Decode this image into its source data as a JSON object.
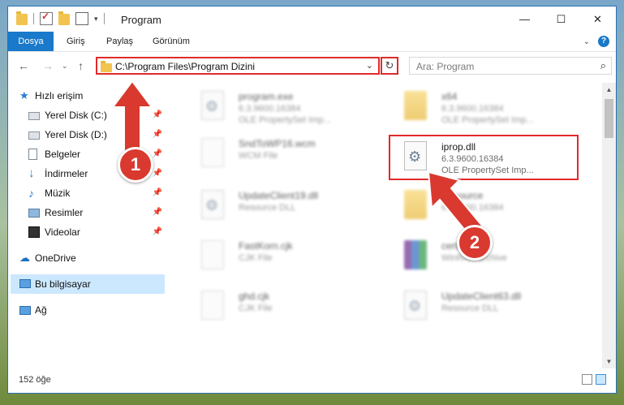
{
  "window": {
    "title": "Program",
    "controls": {
      "minimize": "—",
      "maximize": "☐",
      "close": "✕"
    }
  },
  "ribbon": {
    "tabs": [
      "Dosya",
      "Giriş",
      "Paylaş",
      "Görünüm"
    ],
    "accent": "#1979ca"
  },
  "address": {
    "path": "C:\\Program Files\\Program Dizini",
    "search_placeholder": "Ara: Program"
  },
  "sidebar": {
    "quick_access": "Hızlı erişim",
    "pinned": [
      {
        "label": "Yerel Disk (C:)",
        "icon": "drive-icon"
      },
      {
        "label": "Yerel Disk (D:)",
        "icon": "drive-icon"
      },
      {
        "label": "Belgeler",
        "icon": "documents-icon"
      },
      {
        "label": "İndirmeler",
        "icon": "download-icon"
      },
      {
        "label": "Müzik",
        "icon": "music-icon"
      },
      {
        "label": "Resimler",
        "icon": "pictures-icon"
      },
      {
        "label": "Videolar",
        "icon": "videos-icon"
      }
    ],
    "onedrive": "OneDrive",
    "this_pc": "Bu bilgisayar",
    "network": "Ağ"
  },
  "files": [
    {
      "name": "program.exe",
      "meta1": "6.3.9600.16384",
      "meta2": "OLE PropertySet Imp...",
      "icon": "exe-icon"
    },
    {
      "name": "x64",
      "meta1": "6.3.9600.16384",
      "meta2": "OLE PropertySet Imp...",
      "icon": "folder-icon"
    },
    {
      "name": "SndToWP16.wcm",
      "meta1": "WCM File",
      "meta2": "",
      "icon": "document-icon"
    },
    {
      "name": "iprop.dll",
      "meta1": "6.3.9600.16384",
      "meta2": "OLE PropertySet Imp...",
      "icon": "dll-gear-icon"
    },
    {
      "name": "UpdateClient19.dll",
      "meta1": "Resource DLL",
      "meta2": "",
      "icon": "dll-gear-icon"
    },
    {
      "name": "Resource",
      "meta1": "6.3.9600.16384",
      "meta2": "",
      "icon": "folder-icon"
    },
    {
      "name": "FastKorn.cjk",
      "meta1": "CJK File",
      "meta2": "",
      "icon": "document-icon"
    },
    {
      "name": "certif...cab",
      "meta1": "WinRAR archive",
      "meta2": "",
      "icon": "archive-icon"
    },
    {
      "name": "ghd.cjk",
      "meta1": "CJK File",
      "meta2": "",
      "icon": "document-icon"
    },
    {
      "name": "UpdateClient63.dll",
      "meta1": "Resource DLL",
      "meta2": "",
      "icon": "dll-gear-icon"
    }
  ],
  "status": {
    "item_count": "152 öğe"
  },
  "annotations": {
    "step1": "1",
    "step2": "2",
    "color": "#d9392f"
  }
}
